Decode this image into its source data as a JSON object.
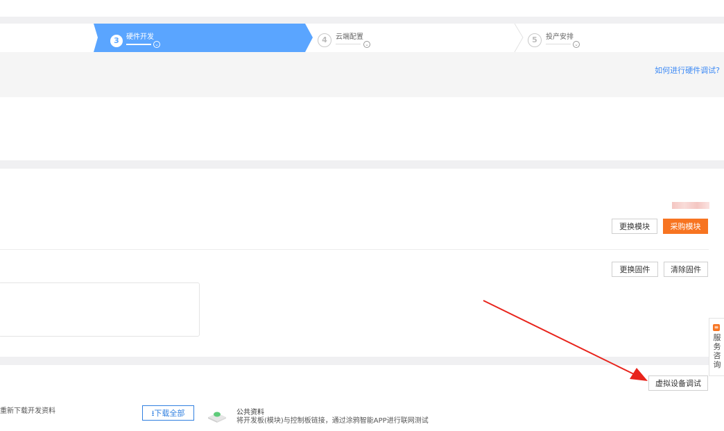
{
  "stepper": {
    "steps": [
      {
        "number": "3",
        "label": "硬件开发",
        "state": "active"
      },
      {
        "number": "4",
        "label": "云端配置",
        "state": "inactive"
      },
      {
        "number": "5",
        "label": "投产安排",
        "state": "inactive"
      }
    ],
    "dropdown_glyph": "⌄"
  },
  "help": {
    "link_text": "如何进行硬件调试?"
  },
  "module": {
    "change_label": "更换模块",
    "buy_label": "采购模块"
  },
  "firmware": {
    "change_label": "更换固件",
    "clear_label": "清除固件"
  },
  "debug": {
    "virtual_device_label": "虚拟设备调试"
  },
  "resources": {
    "redownload_text": "重新下载开发资料",
    "download_all_label": "下载全部",
    "download_icon": "download-icon",
    "public_title": "公共资料",
    "public_desc": "将开发板(模块)与控制板链接，通过涂鸦智能APP进行联网测试"
  },
  "side_widget": {
    "text": "服务咨询",
    "icon": "chat-icon"
  },
  "colors": {
    "step_active": "#5aa5ff",
    "accent_orange": "#f77421",
    "link_blue": "#3a88f5",
    "annotation_red": "#e8241c"
  }
}
